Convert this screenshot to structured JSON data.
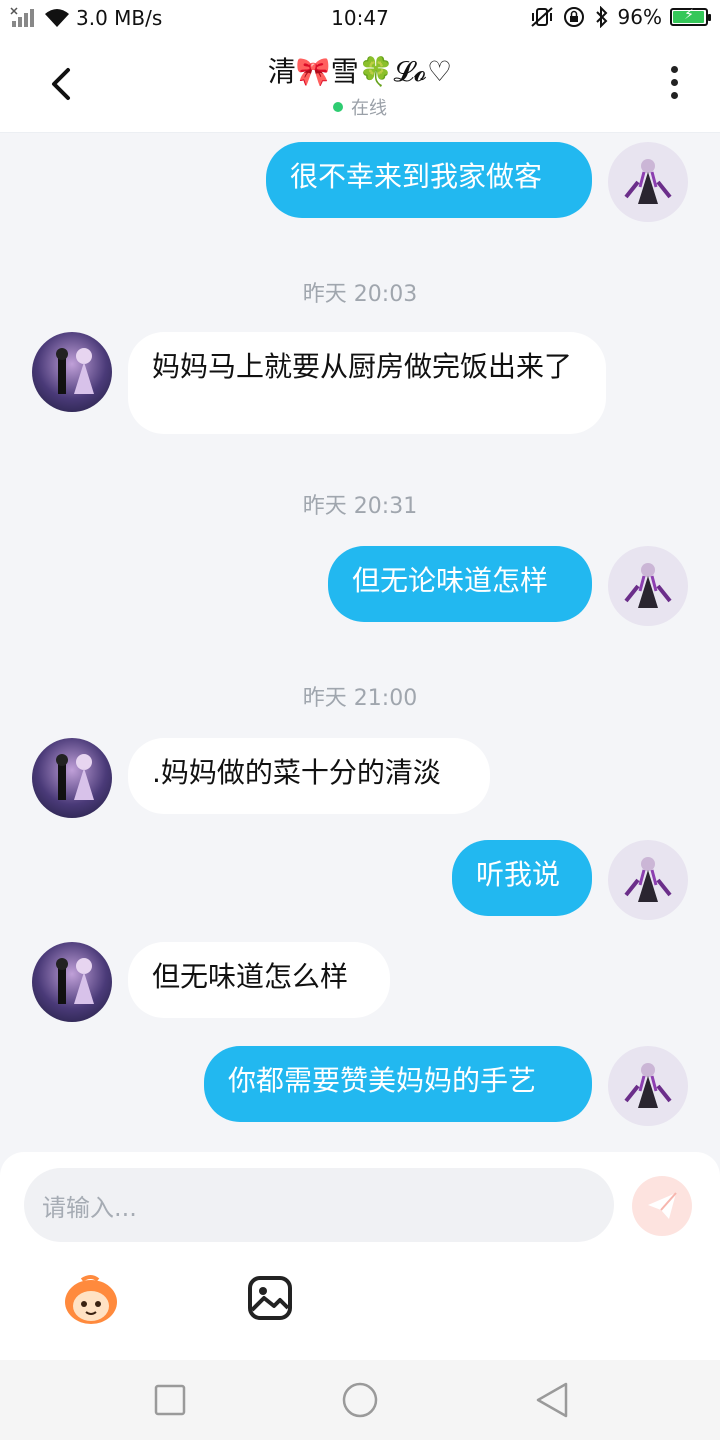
{
  "status_bar": {
    "network_speed": "3.0 MB/s",
    "time": "10:47",
    "battery_percent": "96%",
    "battery_level": 0.96,
    "battery_color": "#35c759"
  },
  "header": {
    "title": "清🎀雪🍀𝓛𝓸♡",
    "presence": "在线",
    "presence_color": "#2ecc71"
  },
  "messages": [
    {
      "type": "out",
      "text": "很不幸来到我家做客"
    },
    {
      "type": "time",
      "text": "昨天 20:03"
    },
    {
      "type": "in",
      "text": "妈妈马上就要从厨房做完饭出来了"
    },
    {
      "type": "time",
      "text": "昨天 20:31"
    },
    {
      "type": "out",
      "text": "但无论味道怎样"
    },
    {
      "type": "time",
      "text": "昨天 21:00"
    },
    {
      "type": "in",
      "text": ".妈妈做的菜十分的清淡"
    },
    {
      "type": "out",
      "text": "听我说"
    },
    {
      "type": "in",
      "text": "但无味道怎么样"
    },
    {
      "type": "out",
      "text": "你都需要赞美妈妈的手艺"
    }
  ],
  "composer": {
    "placeholder": "请输入...",
    "icons": [
      "emoji-icon",
      "image-icon",
      "send-icon"
    ]
  },
  "navbar": {
    "icons": [
      "recent-apps-icon",
      "home-icon",
      "back-icon"
    ]
  },
  "colors": {
    "outgoing_bubble": "#22b8f0",
    "incoming_bubble": "#ffffff",
    "chat_background": "#f4f5f8"
  }
}
